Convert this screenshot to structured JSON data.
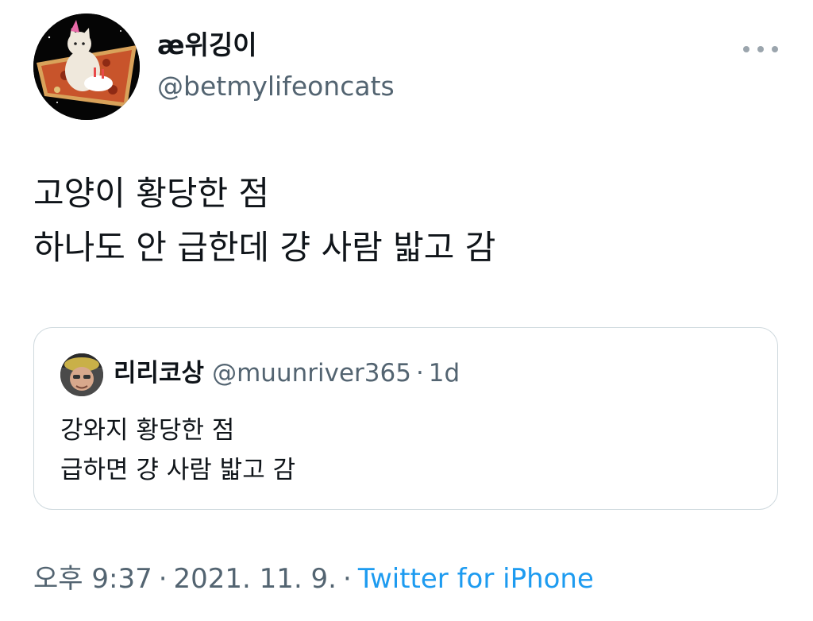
{
  "author": {
    "display_name": "æ위깅이",
    "handle": "@betmylifeoncats",
    "avatar_icon": "cat-on-pizza-avatar"
  },
  "more_icon": "more-horizontal-icon",
  "tweet": {
    "lines": [
      "고양이 황당한 점",
      "하나도 안 급한데 걍 사람 밟고 감"
    ]
  },
  "quote": {
    "display_name": "리리코상",
    "handle": "@muunriver365",
    "separator": "·",
    "time": "1d",
    "avatar_icon": "person-avatar",
    "lines": [
      "강와지 황당한 점",
      "급하면 걍 사람 밟고 감"
    ]
  },
  "meta": {
    "time": "오후 9:37",
    "sep1": "·",
    "date": "2021. 11. 9.",
    "sep2": "·",
    "source": "Twitter for iPhone"
  },
  "colors": {
    "text_primary": "#0f1419",
    "text_secondary": "#536471",
    "link": "#1d9bf0",
    "border": "#cfd9de"
  }
}
